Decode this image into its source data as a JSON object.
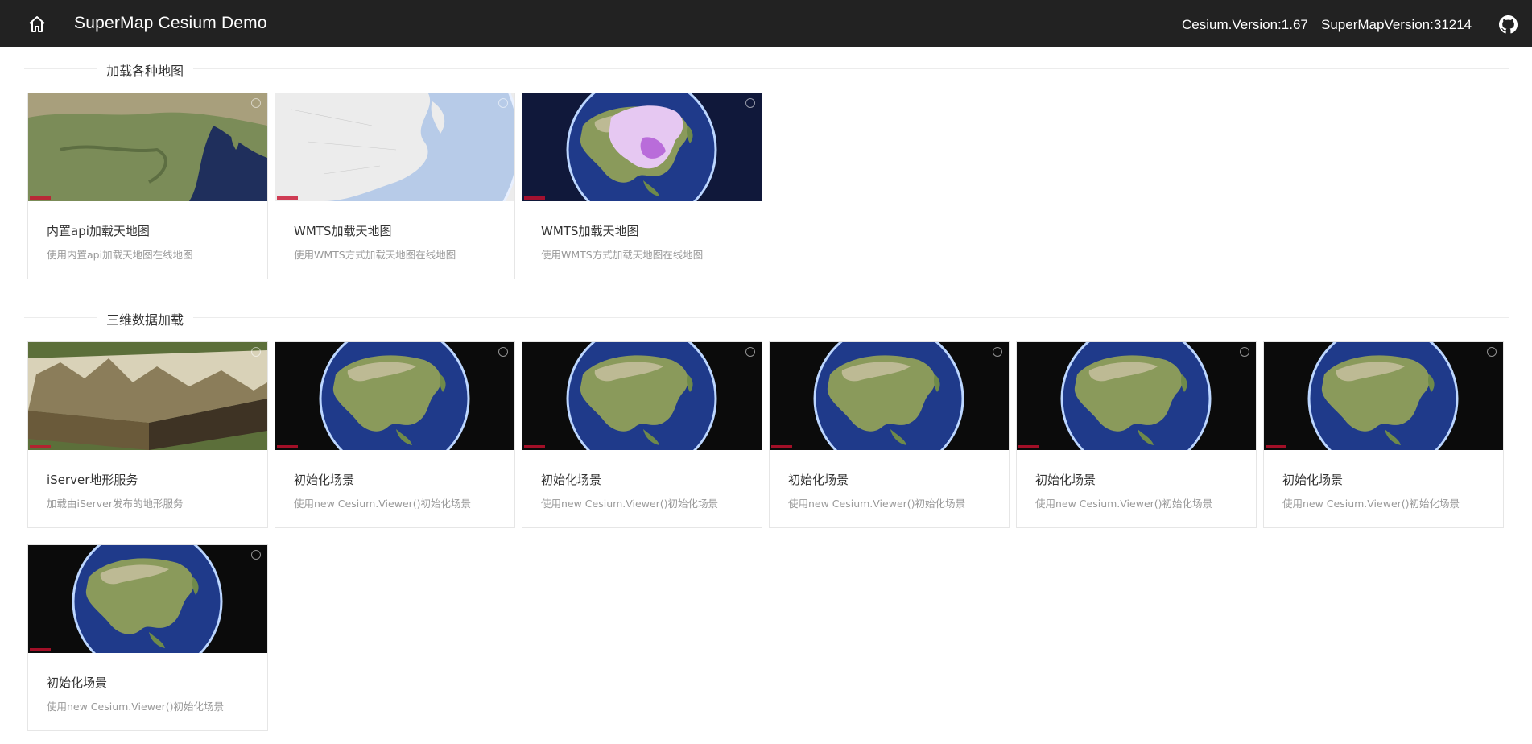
{
  "header": {
    "title": "SuperMap Cesium Demo",
    "cesium_version": "Cesium.Version:1.67",
    "supermap_version": "SuperMapVersion:31214",
    "home_icon": "home-icon",
    "github_icon": "github-icon"
  },
  "sections": [
    {
      "title": "加载各种地图",
      "cards": [
        {
          "title": "内置api加载天地图",
          "desc": "使用内置api加载天地图在线地图",
          "thumb": "satellite-map"
        },
        {
          "title": "WMTS加载天地图",
          "desc": "使用WMTS方式加载天地图在线地图",
          "thumb": "vector-globe"
        },
        {
          "title": "WMTS加载天地图",
          "desc": "使用WMTS方式加载天地图在线地图",
          "thumb": "china-overlay-globe"
        }
      ]
    },
    {
      "title": "三维数据加载",
      "cards": [
        {
          "title": "iServer地形服务",
          "desc": "加载由iServer发布的地形服务",
          "thumb": "terrain"
        },
        {
          "title": "初始化场景",
          "desc": "使用new Cesium.Viewer()初始化场景",
          "thumb": "globe"
        },
        {
          "title": "初始化场景",
          "desc": "使用new Cesium.Viewer()初始化场景",
          "thumb": "globe"
        },
        {
          "title": "初始化场景",
          "desc": "使用new Cesium.Viewer()初始化场景",
          "thumb": "globe"
        },
        {
          "title": "初始化场景",
          "desc": "使用new Cesium.Viewer()初始化场景",
          "thumb": "globe"
        },
        {
          "title": "初始化场景",
          "desc": "使用new Cesium.Viewer()初始化场景",
          "thumb": "globe"
        },
        {
          "title": "初始化场景",
          "desc": "使用new Cesium.Viewer()初始化场景",
          "thumb": "globe"
        }
      ]
    }
  ],
  "colors": {
    "header_bg": "#222222",
    "ocean": "#1d2d6b",
    "land": "#8a9a5b"
  }
}
